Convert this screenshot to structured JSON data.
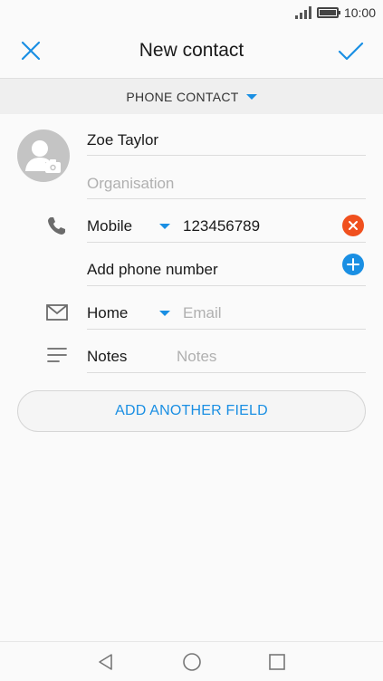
{
  "status_bar": {
    "time": "10:00",
    "signal_icon": "signal-icon",
    "battery_icon": "battery-icon"
  },
  "header": {
    "title": "New contact",
    "close_icon": "close-icon",
    "save_icon": "checkmark-icon",
    "accent_color": "#1a8fe3"
  },
  "account": {
    "label": "PHONE CONTACT"
  },
  "form": {
    "name_value": "Zoe Taylor",
    "organisation_placeholder": "Organisation",
    "phone_type": "Mobile",
    "phone_value": "123456789",
    "add_phone_label": "Add phone number",
    "email_type": "Home",
    "email_placeholder": "Email",
    "notes_label": "Notes",
    "notes_placeholder": "Notes"
  },
  "actions": {
    "add_field_label": "ADD ANOTHER FIELD"
  },
  "colors": {
    "remove": "#f0501e",
    "add": "#1a8fe3"
  }
}
